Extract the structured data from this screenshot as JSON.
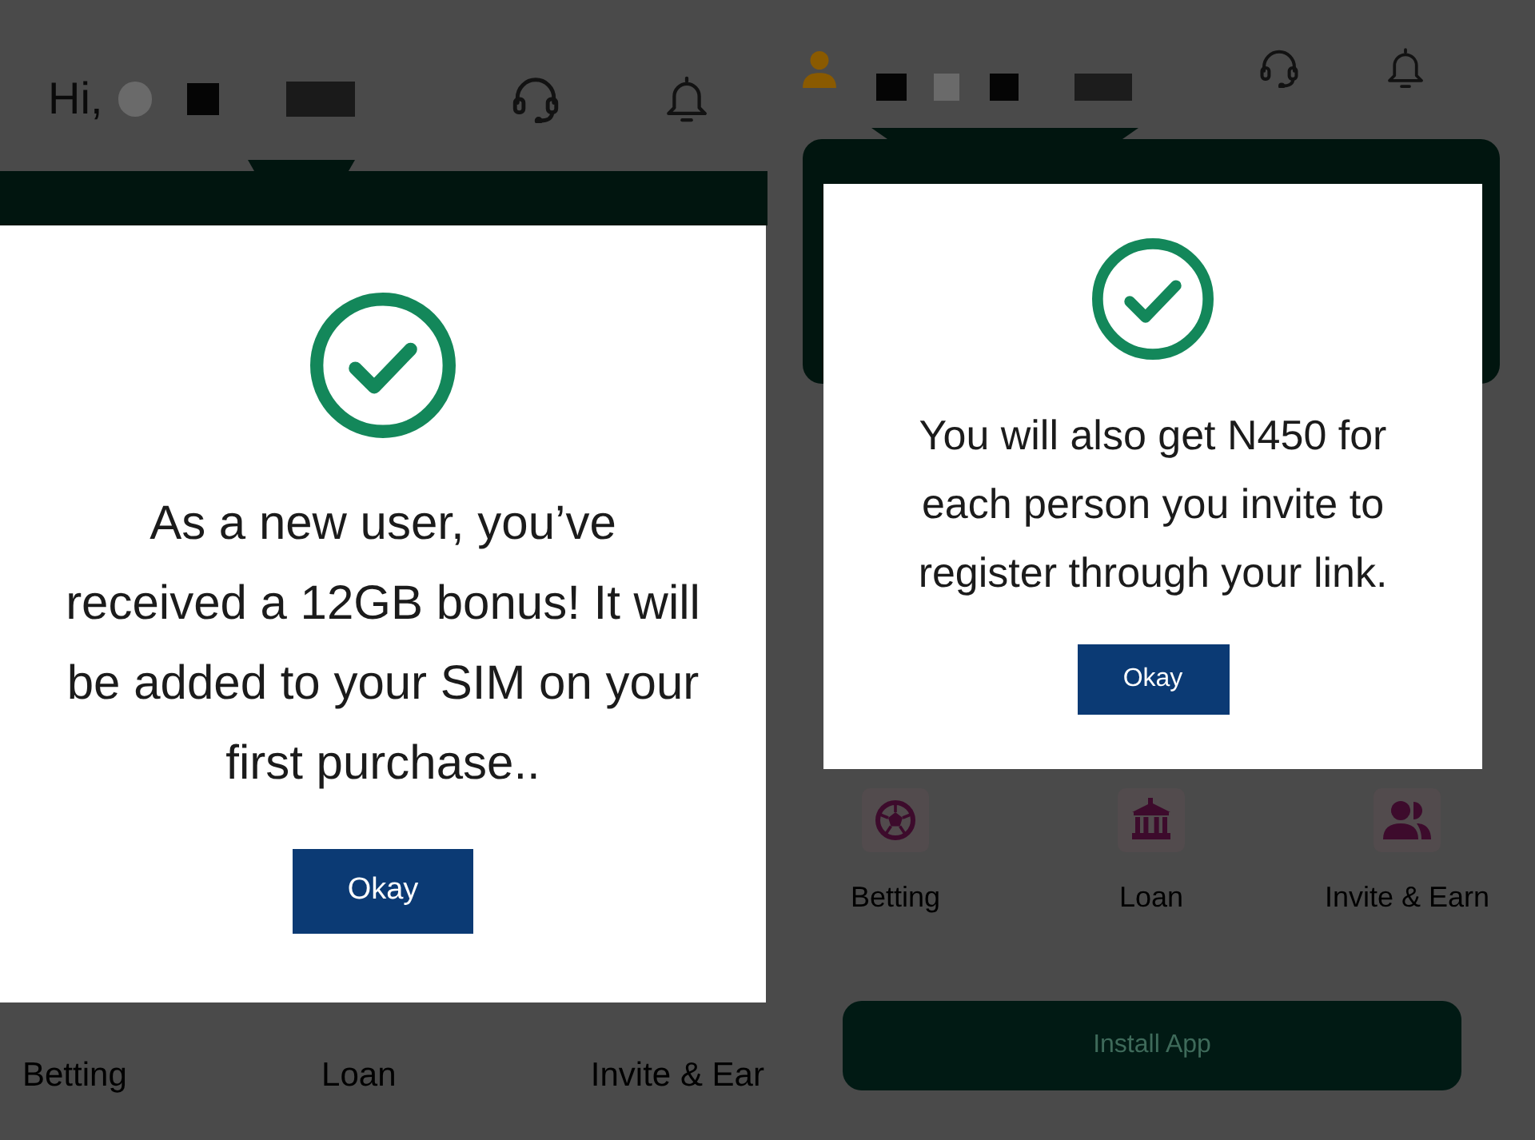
{
  "screens": [
    {
      "header": {
        "greeting": "Hi,"
      },
      "dialog": {
        "message_lines": [
          "As a new user, you’ve",
          "received a 12GB bonus! It will",
          "be added to your SIM on your",
          "first purchase.."
        ],
        "button": "Okay"
      },
      "shortcuts": [
        {
          "label": "Betting"
        },
        {
          "label": "Loan"
        },
        {
          "label": "Invite & Ear"
        }
      ]
    },
    {
      "dialog": {
        "message_lines": [
          "You will also get N450 for",
          "each person you invite to",
          "register through your link."
        ],
        "button": "Okay"
      },
      "shortcuts": [
        {
          "label": "Betting"
        },
        {
          "label": "Loan"
        },
        {
          "label": "Invite & Earn"
        }
      ],
      "install_button": "Install App"
    }
  ]
}
